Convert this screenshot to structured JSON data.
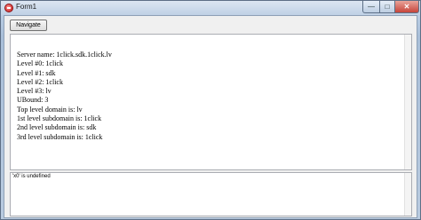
{
  "window": {
    "title": "Form1",
    "minimize_glyph": "—",
    "maximize_glyph": "□",
    "close_glyph": "✕"
  },
  "toolbar": {
    "navigate_label": "Navigate"
  },
  "output": {
    "lines": [
      "Server name: 1click.sdk.1click.lv",
      "Level #0: 1click",
      "Level #1: sdk",
      "Level #2: 1click",
      "Level #3: lv",
      "UBound: 3",
      "Top level domain is: lv",
      "1st level subdomain is: 1click",
      "2nd level subdomain is: sdk",
      "3rd level subdomain is: 1click"
    ]
  },
  "error": {
    "text": "'x0' is undefined"
  },
  "colors": {
    "close_button": "#c6443a",
    "title_glass": "#b7cbe2"
  }
}
